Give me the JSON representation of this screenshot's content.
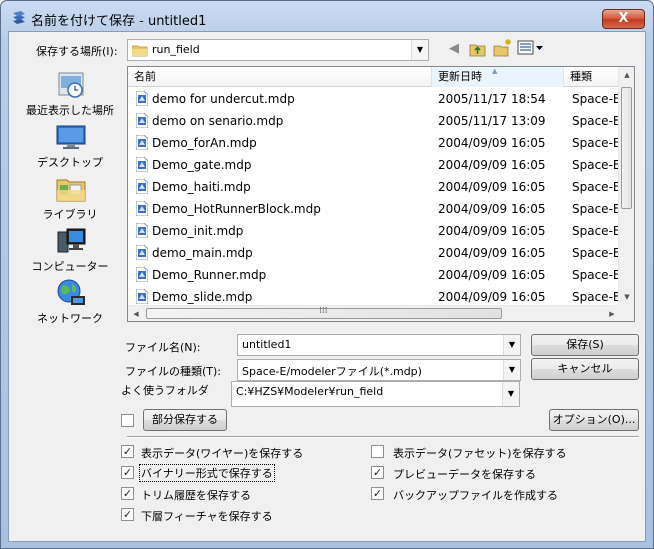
{
  "window": {
    "title": "名前を付けて保存 - untitled1",
    "close_label": "X"
  },
  "location": {
    "label": "保存する場所(I):",
    "value": "run_field"
  },
  "places": [
    {
      "id": "recent",
      "label": "最近表示した場所"
    },
    {
      "id": "desktop",
      "label": "デスクトップ"
    },
    {
      "id": "library",
      "label": "ライブラリ"
    },
    {
      "id": "computer",
      "label": "コンピューター"
    },
    {
      "id": "network",
      "label": "ネットワーク"
    }
  ],
  "columns": {
    "name": "名前",
    "date": "更新日時",
    "type": "種類"
  },
  "files": [
    {
      "name": "demo for undercut.mdp",
      "date": "2005/11/17 18:54",
      "type": "Space-E/Modeler"
    },
    {
      "name": "demo on senario.mdp",
      "date": "2005/11/17 13:09",
      "type": "Space-E/Modeler"
    },
    {
      "name": "Demo_forAn.mdp",
      "date": "2004/09/09 16:05",
      "type": "Space-E/Modeler"
    },
    {
      "name": "Demo_gate.mdp",
      "date": "2004/09/09 16:05",
      "type": "Space-E/Modeler"
    },
    {
      "name": "Demo_haiti.mdp",
      "date": "2004/09/09 16:05",
      "type": "Space-E/Modeler"
    },
    {
      "name": "Demo_HotRunnerBlock.mdp",
      "date": "2004/09/09 16:05",
      "type": "Space-E/Modeler"
    },
    {
      "name": "Demo_init.mdp",
      "date": "2004/09/09 16:05",
      "type": "Space-E/Modeler"
    },
    {
      "name": "demo_main.mdp",
      "date": "2004/09/09 16:05",
      "type": "Space-E/Modeler"
    },
    {
      "name": "Demo_Runner.mdp",
      "date": "2004/09/09 16:05",
      "type": "Space-E/Modeler"
    },
    {
      "name": "Demo_slide.mdp",
      "date": "2004/09/09 16:05",
      "type": "Space-E/Modeler"
    }
  ],
  "filename": {
    "label": "ファイル名(N):",
    "value": "untitled1"
  },
  "filetype": {
    "label": "ファイルの種類(T):",
    "value": "Space-E/modelerファイル(*.mdp)"
  },
  "favorite": {
    "label": "よく使うフォルダ",
    "value": "C:¥HZS¥Modeler¥run_field"
  },
  "buttons": {
    "save": "保存(S)",
    "cancel": "キャンセル",
    "partial_save": "部分保存する",
    "options": "オプション(O)..."
  },
  "options": {
    "display_wire": {
      "label": "表示データ(ワイヤー)を保存する",
      "checked": true
    },
    "display_facet": {
      "label": "表示データ(ファセット)を保存する",
      "checked": false
    },
    "binary": {
      "label": "バイナリー形式で保存する",
      "checked": true
    },
    "preview": {
      "label": "プレビューデータを保存する",
      "checked": true
    },
    "trim_history": {
      "label": "トリム履歴を保存する",
      "checked": true
    },
    "backup": {
      "label": "バックアップファイルを作成する",
      "checked": true
    },
    "lower_feature": {
      "label": "下層フィーチャを保存する",
      "checked": true
    }
  },
  "checkmark": "✓",
  "partial_checked": false
}
